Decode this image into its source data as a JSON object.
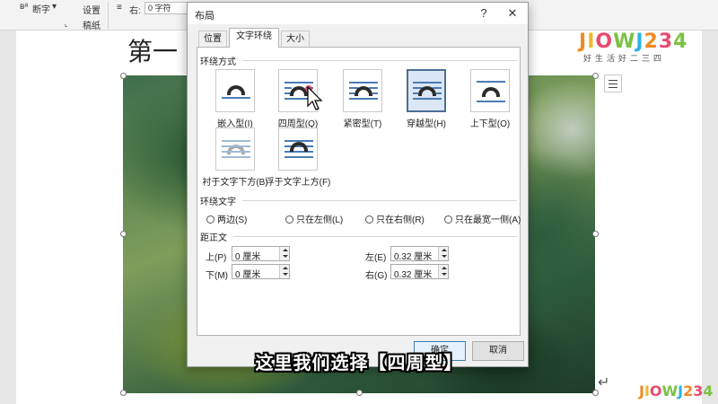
{
  "ribbon": {
    "hyphenation_label": "断字",
    "indent_right_label": "右:",
    "indent_right_value": "0 字符",
    "settings_label": "设置",
    "manuscript_label": "稿纸"
  },
  "document": {
    "heading": "第一"
  },
  "logo": {
    "text": "JIOWJ234",
    "subtitle": "好生活好二三四",
    "small_text": "JIOWJ234",
    "colors": [
      "#f08a24",
      "#f5b62a",
      "#e84b6f",
      "#7ac143",
      "#2bb3e5",
      "#f08a24",
      "#e84b6f",
      "#7ac143"
    ]
  },
  "dialog": {
    "title": "布局",
    "help_label": "?",
    "close_label": "✕",
    "tabs": [
      {
        "label": "位置",
        "active": false
      },
      {
        "label": "文字环绕",
        "active": true
      },
      {
        "label": "大小",
        "active": false
      }
    ],
    "wrap_style": {
      "section_label": "环绕方式",
      "options": [
        {
          "label": "嵌入型(I)",
          "icon": "inline-with-text-icon",
          "selected": false
        },
        {
          "label": "四周型(Q)",
          "icon": "square-wrap-icon",
          "selected": false
        },
        {
          "label": "紧密型(T)",
          "icon": "tight-wrap-icon",
          "selected": false
        },
        {
          "label": "穿越型(H)",
          "icon": "through-wrap-icon",
          "selected": true
        },
        {
          "label": "上下型(O)",
          "icon": "top-bottom-wrap-icon",
          "selected": false
        },
        {
          "label": "衬于文字下方(B)",
          "icon": "behind-text-icon",
          "selected": false
        },
        {
          "label": "浮于文字上方(F)",
          "icon": "in-front-of-text-icon",
          "selected": false
        }
      ]
    },
    "wrap_text": {
      "section_label": "环绕文字",
      "options": [
        {
          "label": "两边(S)"
        },
        {
          "label": "只在左侧(L)"
        },
        {
          "label": "只在右侧(R)"
        },
        {
          "label": "只在最宽一侧(A)"
        }
      ]
    },
    "distance": {
      "section_label": "距正文",
      "top_label": "上(P)",
      "top_value": "0 厘米",
      "bottom_label": "下(M)",
      "bottom_value": "0 厘米",
      "left_label": "左(E)",
      "left_value": "0.32 厘米",
      "right_label": "右(G)",
      "right_value": "0.32 厘米"
    },
    "ok_label": "确定",
    "cancel_label": "取消"
  },
  "subtitle": "这里我们选择【四周型】",
  "accent_color": "#4d6e94"
}
